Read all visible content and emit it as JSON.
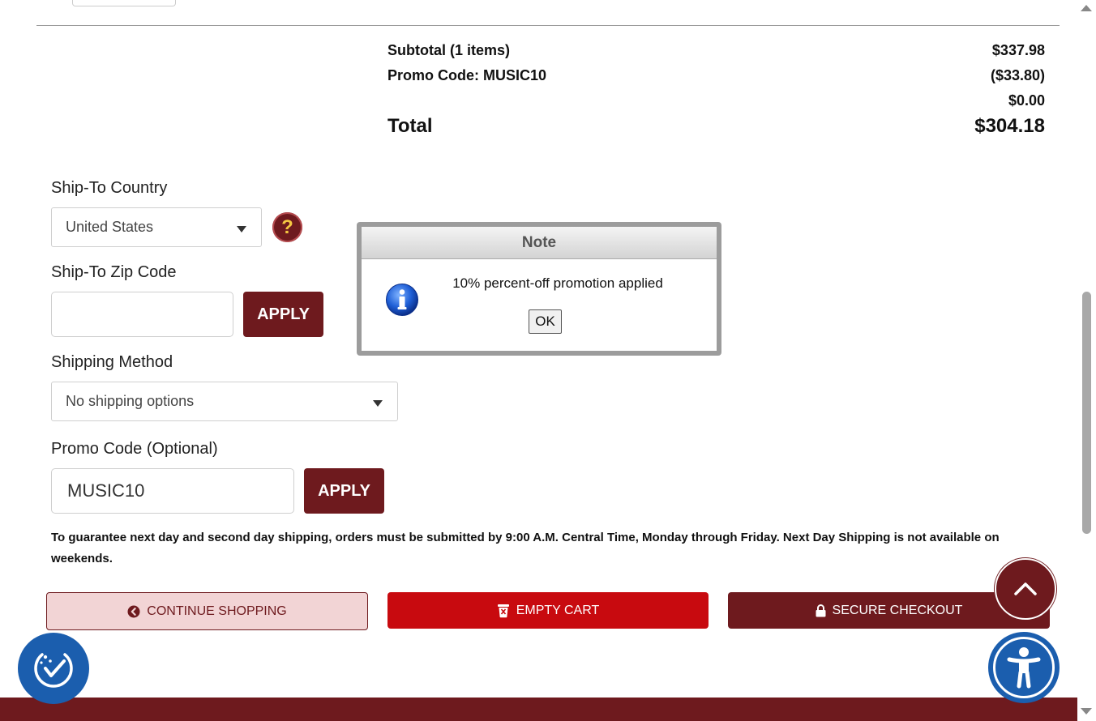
{
  "summary": {
    "subtotal_label": "Subtotal (1 items)",
    "subtotal_value": "$337.98",
    "promo_label": "Promo Code: MUSIC10",
    "promo_value": "($33.80)",
    "shipping_value": "$0.00",
    "total_label": "Total",
    "total_value": "$304.18"
  },
  "form": {
    "country_label": "Ship-To Country",
    "country_value": "United States",
    "help_icon": "?",
    "zip_label": "Ship-To Zip Code",
    "zip_value": "",
    "zip_apply": "APPLY",
    "shipping_label": "Shipping Method",
    "shipping_value": "No shipping options",
    "promo_label": "Promo Code (Optional)",
    "promo_value": "MUSIC10",
    "promo_apply": "APPLY"
  },
  "notice": "To guarantee next day and second day shipping, orders must be submitted by 9:00 A.M. Central Time, Monday through Friday. Next Day Shipping is not available on weekends.",
  "actions": {
    "continue": "CONTINUE SHOPPING",
    "empty": "EMPTY CART",
    "checkout": "SECURE CHECKOUT"
  },
  "dialog": {
    "title": "Note",
    "message": "10% percent-off promotion applied",
    "ok": "OK"
  },
  "colors": {
    "brand": "#6e1a1e",
    "empty_cart": "#c80a0f",
    "accessibility": "#1b5eae"
  },
  "icons": [
    "help-icon",
    "chevron-left-circle-icon",
    "trash-icon",
    "lock-icon",
    "chevron-up-icon",
    "info-icon",
    "accessibility-check-icon",
    "accessibility-person-icon"
  ]
}
